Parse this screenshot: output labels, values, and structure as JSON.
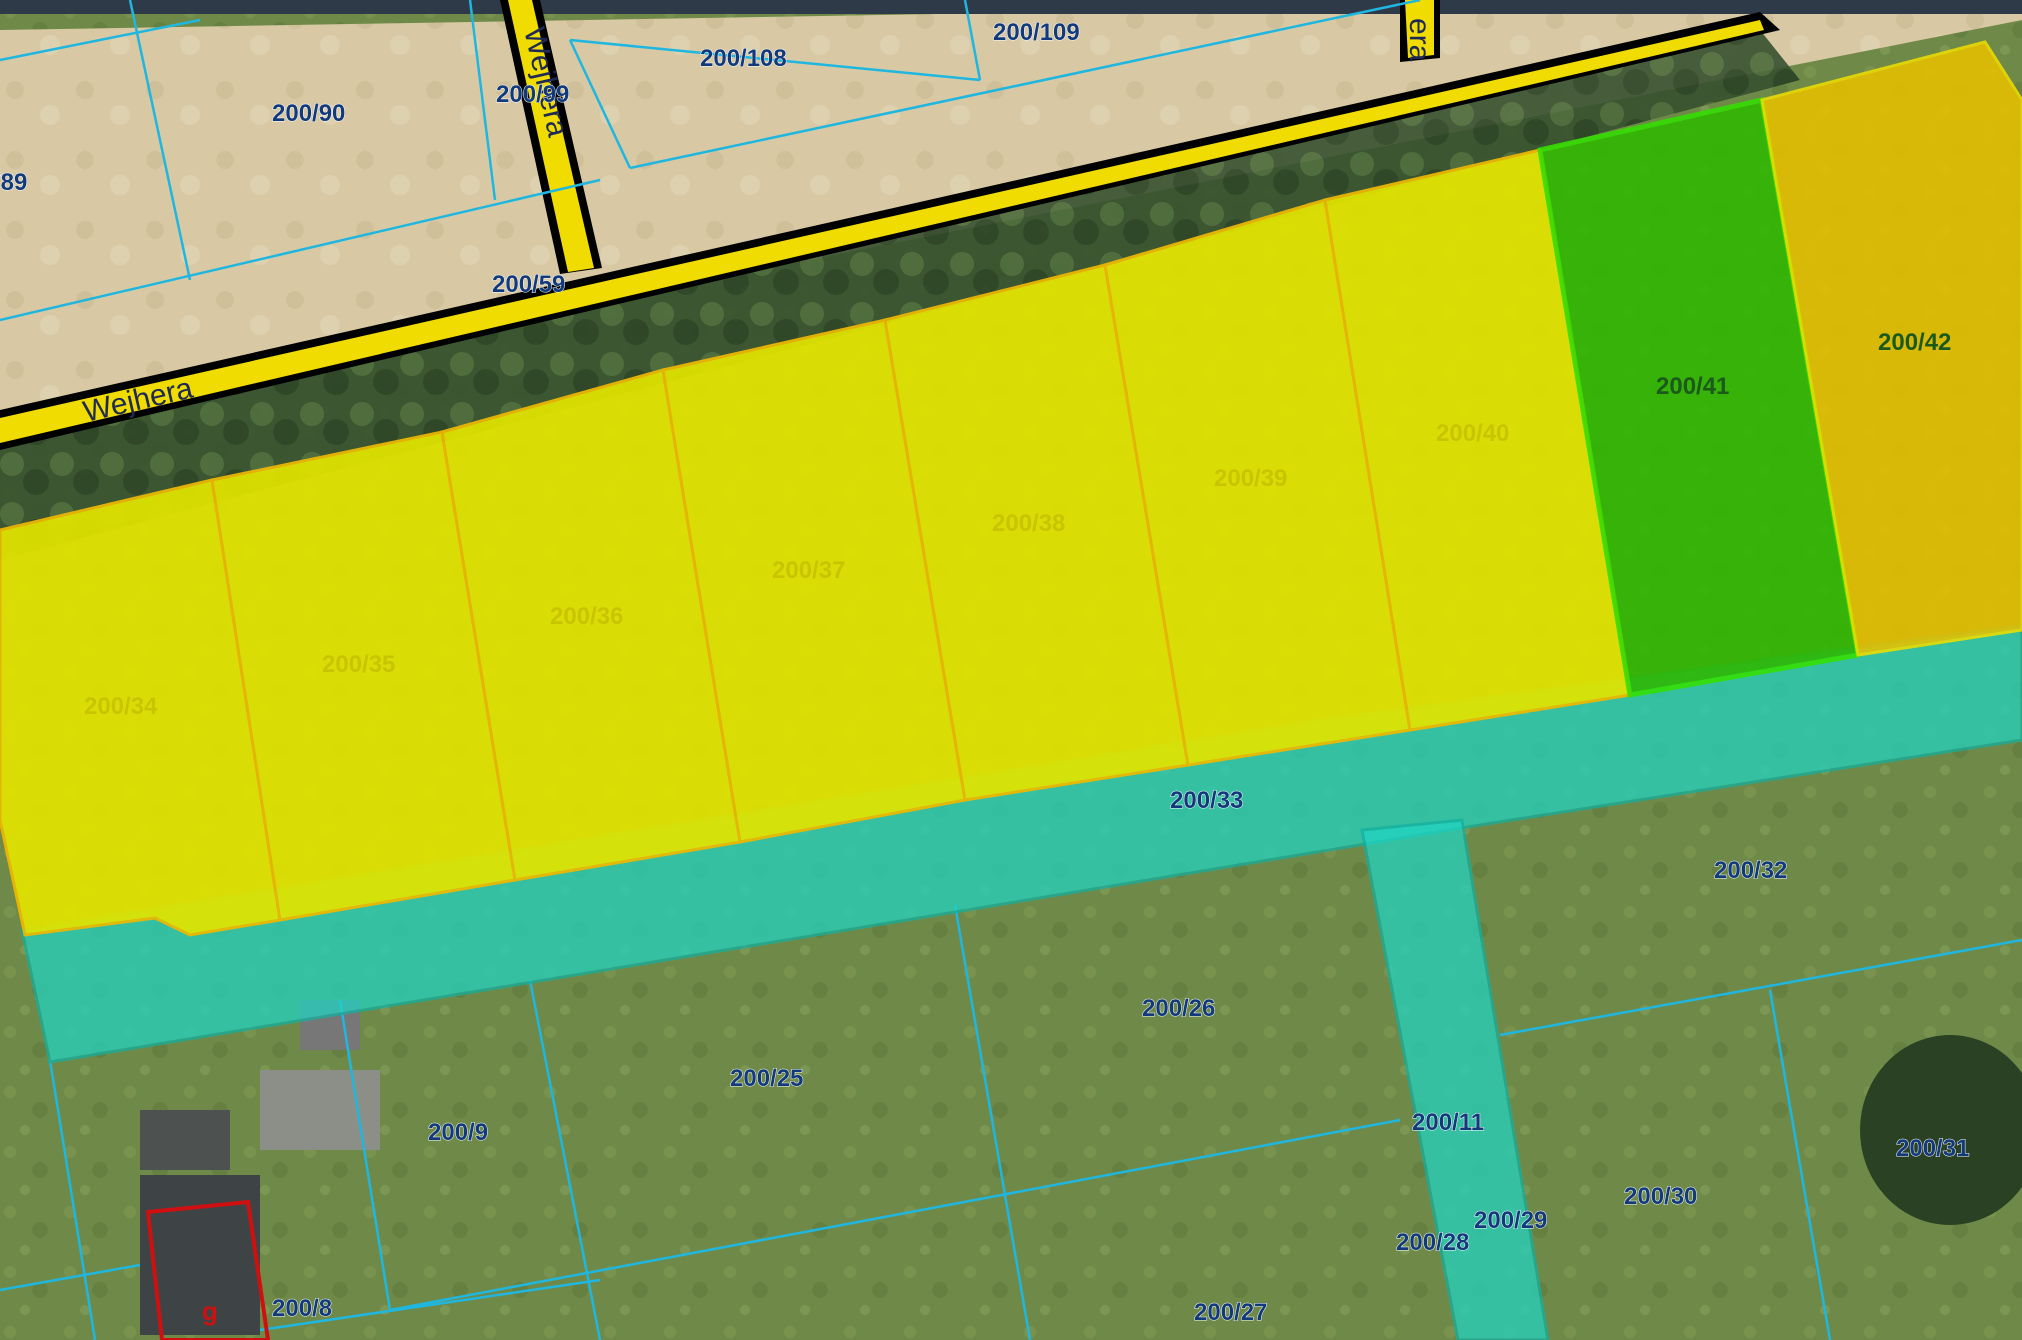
{
  "street_name": "Wejhera",
  "street_label_partial": "era",
  "building_marker": "g",
  "parcels": {
    "p200_90": "200/90",
    "p200_89": "/89",
    "p200_99": "200/99",
    "p200_108": "200/108",
    "p200_109": "200/109",
    "p200_59": "200/59",
    "p200_34": "200/34",
    "p200_35": "200/35",
    "p200_36": "200/36",
    "p200_37": "200/37",
    "p200_38": "200/38",
    "p200_39": "200/39",
    "p200_40": "200/40",
    "p200_41": "200/41",
    "p200_42": "200/42",
    "p200_33": "200/33",
    "p200_32": "200/32",
    "p200_26": "200/26",
    "p200_25": "200/25",
    "p200_9": "200/9",
    "p200_11": "200/11",
    "p200_29": "200/29",
    "p200_28": "200/28",
    "p200_30": "200/30",
    "p200_31": "200/31",
    "p200_8": "200/8",
    "p200_27": "200/27"
  },
  "colors": {
    "parcel_boundary": "#1fb6e0",
    "selected_yellow": "#e2e400",
    "selected_green": "#2fb800",
    "selected_orange": "#e8c000",
    "road_fill": "#f0dc00",
    "water_teal": "#1fd6c4",
    "building_outline": "#d01010"
  }
}
